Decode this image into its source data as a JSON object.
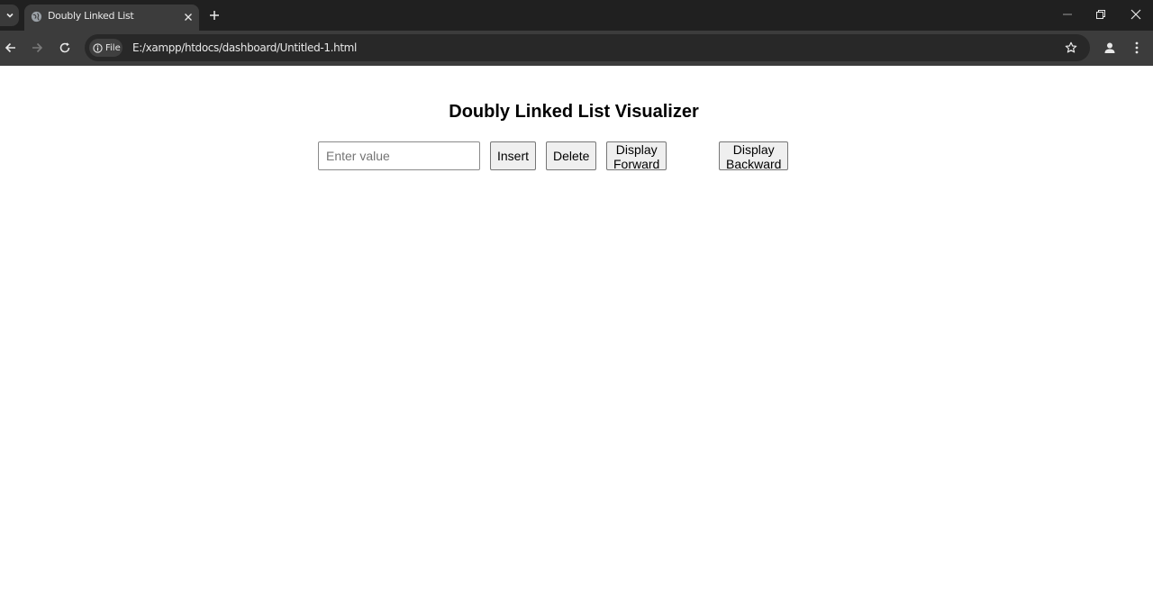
{
  "browser": {
    "tab": {
      "title": "Doubly Linked List",
      "favicon": "globe-icon"
    },
    "address_bar": {
      "site_chip": "File",
      "url": "E:/xampp/htdocs/dashboard/Untitled-1.html"
    },
    "icons": {
      "tab_search": "chevron-down-icon",
      "tab_close": "close-icon",
      "new_tab": "plus-icon",
      "back": "arrow-left-icon",
      "forward": "arrow-right-icon",
      "reload": "reload-icon",
      "site_info": "info-icon",
      "bookmark": "star-icon",
      "profile": "person-icon",
      "menu": "kebab-menu-icon",
      "minimize": "minimize-icon",
      "restore": "restore-icon",
      "close_window": "close-icon"
    },
    "colors": {
      "tabbar": "#202020",
      "toolbar": "#3c3c3c",
      "omnibox": "#282828"
    }
  },
  "page": {
    "heading": "Doubly Linked List Visualizer",
    "input": {
      "placeholder": "Enter value",
      "value": ""
    },
    "buttons": {
      "insert": "Insert",
      "delete": "Delete",
      "display_forward": "Display Forward",
      "display_backward": "Display Backward"
    }
  }
}
